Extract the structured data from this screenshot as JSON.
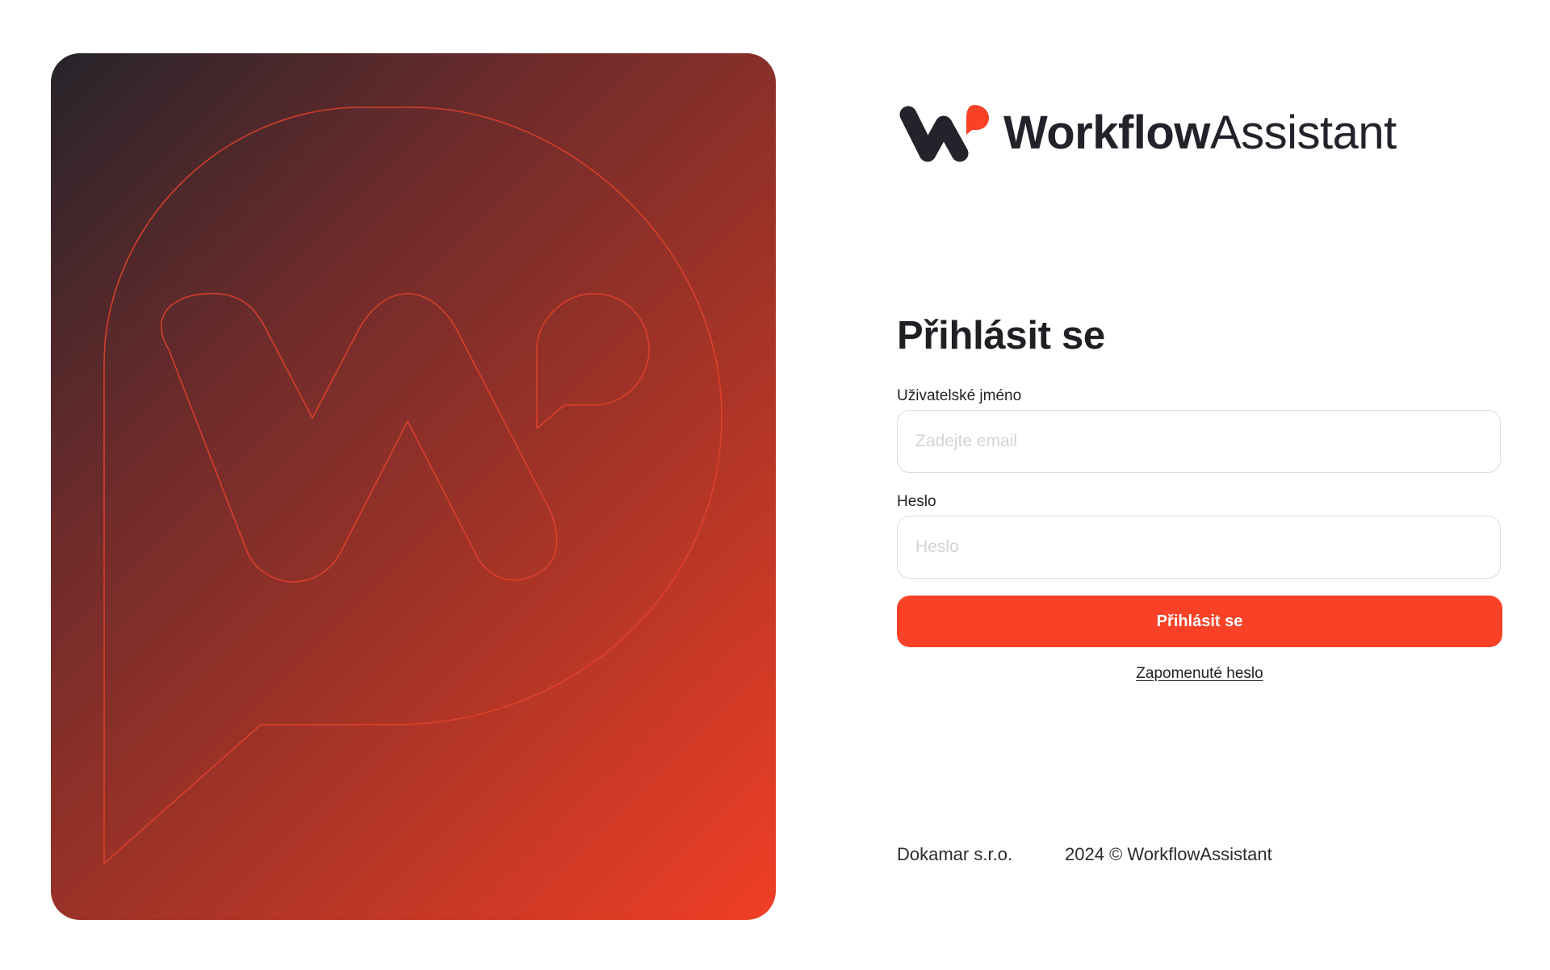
{
  "brand": {
    "name_bold": "Workflow",
    "name_regular": "Assistant",
    "colors": {
      "dark": "#23232b",
      "accent": "#f84127"
    }
  },
  "login": {
    "title": "Přihlásit se",
    "username": {
      "label": "Uživatelské jméno",
      "placeholder": "Zadejte email",
      "value": ""
    },
    "password": {
      "label": "Heslo",
      "placeholder": "Heslo",
      "value": ""
    },
    "submit_label": "Přihlásit se",
    "forgot_label": "Zapomenuté heslo"
  },
  "footer": {
    "company": "Dokamar s.r.o.",
    "copyright": "2024 © WorkflowAssistant"
  },
  "hero": {
    "icon": "speech-bubble-w-logo-outline",
    "gradient_colors": [
      "#26242b",
      "#6b2b2b",
      "#a83427",
      "#f03f25"
    ]
  }
}
